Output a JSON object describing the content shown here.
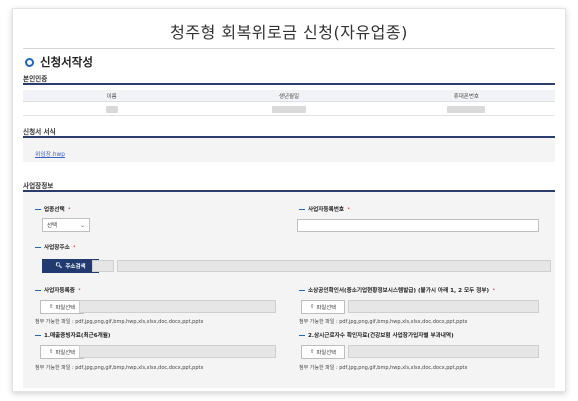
{
  "page_title": "청주형 회복위로금 신청(자유업종)",
  "section_title": "신청서작성",
  "identity": {
    "heading": "본인인증",
    "columns": [
      "이름",
      "생년월일",
      "휴대폰번호"
    ]
  },
  "form_doc": {
    "heading": "신청서 서식",
    "file_link": "위임장.hwp"
  },
  "business": {
    "heading": "사업장정보",
    "industry_label": "업종선택",
    "industry_value": "선택",
    "bizno_label": "사업자등록번호",
    "address_label": "사업장주소",
    "address_button": "주소검색",
    "req_mark": "•"
  },
  "attachments": {
    "button_label": "파일선택",
    "allowed_text": "첨부 가능한 파일 : pdf,jpg,png,gif,bmp,hwp,xls,xlsx,doc,docx,ppt,pptx",
    "items": [
      {
        "label": "사업자등록증",
        "required": true
      },
      {
        "label": "소상공인확인서(중소기업현황정보시스템발급) (불가시 아래 1, 2 모두 정부)",
        "required": true
      },
      {
        "label": "1.매출증빙자료(최근6개월)",
        "required": false
      },
      {
        "label": "2.상시근로자수 확인자료(건강보험 사업장가입자별 부과내역)",
        "required": false
      }
    ]
  },
  "colors": {
    "accent": "#1f66c1",
    "navy": "#213a70",
    "required": "#e0463a",
    "link": "#3a63c8"
  }
}
